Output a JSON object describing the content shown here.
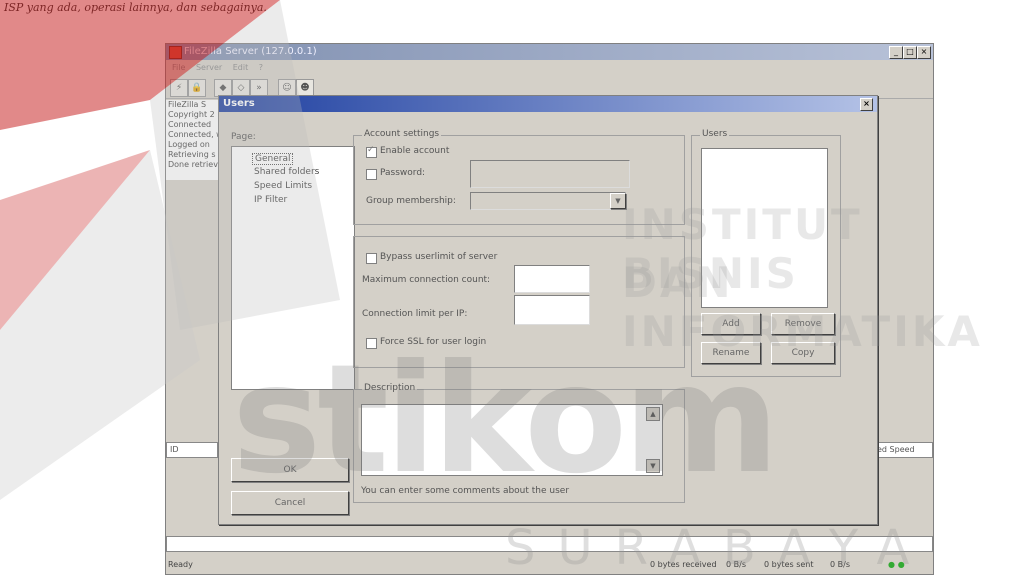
{
  "caption": "ISP yang ada, operasi lainnya, dan sebagainya.",
  "main_window": {
    "title": "FileZilla Server (127.0.0.1)",
    "menu": [
      "File",
      "Server",
      "Edit",
      "?"
    ],
    "log_lines": [
      "FileZilla S",
      "Copyright 2",
      "Connected",
      "Connected, wa",
      "Logged on",
      "Retrieving s",
      "Done retriev"
    ],
    "left_cell": "ID",
    "right_cell": "ed Speed",
    "status": {
      "ready": "Ready",
      "bytes_received": "0 bytes received",
      "rate_received": "0 B/s",
      "bytes_sent": "0 bytes sent",
      "rate_sent": "0 B/s"
    }
  },
  "dialog": {
    "title": "Users",
    "page_label": "Page:",
    "pages": [
      {
        "label": "General",
        "selected": true
      },
      {
        "label": "Shared folders",
        "selected": false
      },
      {
        "label": "Speed Limits",
        "selected": false
      },
      {
        "label": "IP Filter",
        "selected": false
      }
    ],
    "account_settings": {
      "group_label": "Account settings",
      "enable_account": "Enable account",
      "password": "Password:",
      "group_membership": "Group membership:"
    },
    "limits": {
      "bypass": "Bypass userlimit of server",
      "max_connections": "Maximum connection count:",
      "connection_limit_ip": "Connection limit per IP:",
      "force_ssl": "Force SSL for user login"
    },
    "users": {
      "group_label": "Users",
      "add": "Add",
      "remove": "Remove",
      "rename": "Rename",
      "copy": "Copy"
    },
    "description": {
      "group_label": "Description",
      "hint": "You can enter some comments about the user"
    },
    "ok": "OK",
    "cancel": "Cancel"
  },
  "watermark": {
    "line1": "INSTITUT BISNIS",
    "line2": "DAN INFORMATIKA",
    "brand": "stikom",
    "city": "SURABAYA"
  }
}
